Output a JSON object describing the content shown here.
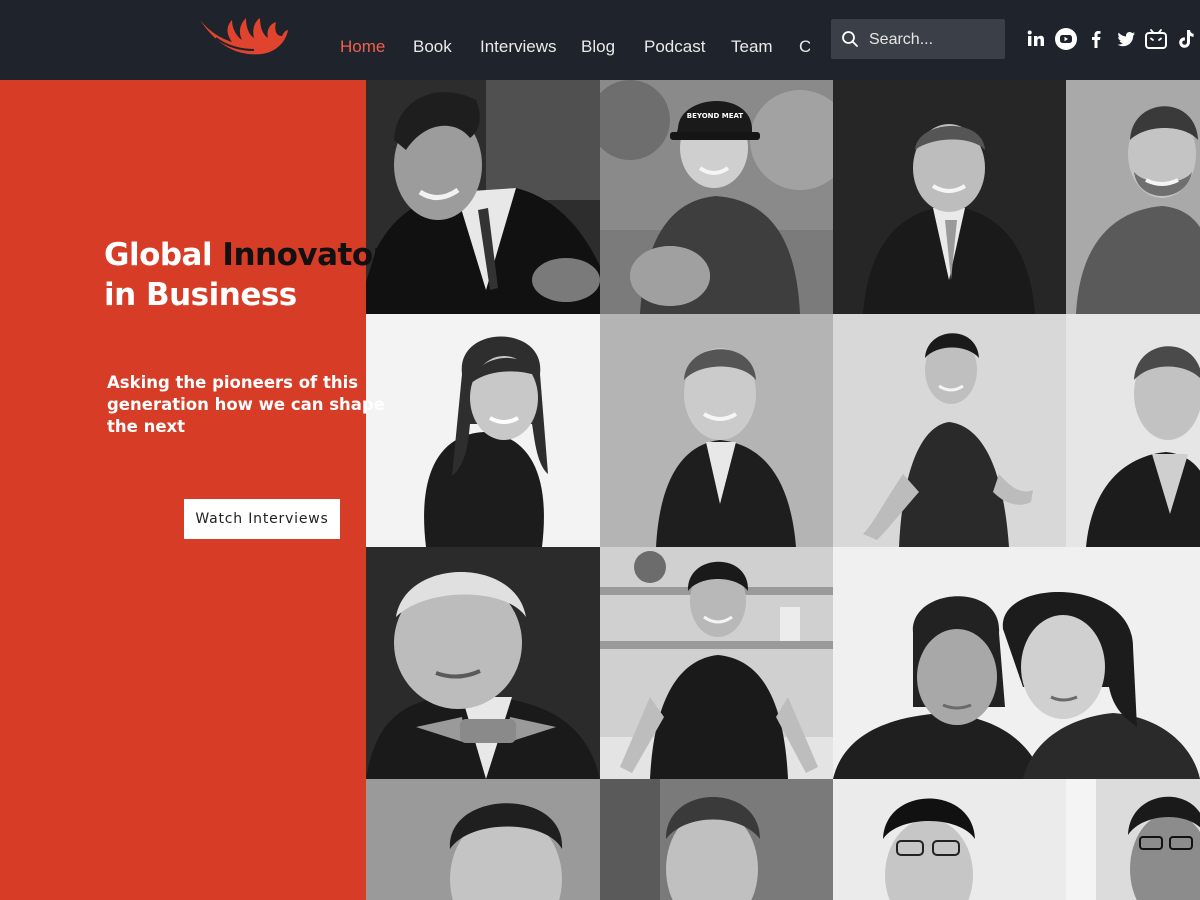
{
  "header": {
    "logo_icon": "flame-wing-logo",
    "nav": [
      {
        "label": "Home",
        "active": true
      },
      {
        "label": "Book"
      },
      {
        "label": "Interviews"
      },
      {
        "label": "Blog"
      },
      {
        "label": "Podcast"
      },
      {
        "label": "Team"
      },
      {
        "label": "C"
      }
    ],
    "search": {
      "placeholder": "Search..."
    },
    "social": [
      "linkedin-icon",
      "youtube-icon",
      "facebook-icon",
      "twitter-icon",
      "bilibili-icon",
      "tiktok-icon"
    ]
  },
  "hero": {
    "title_part1": "Global ",
    "title_part2": "Innovators",
    "title_line2": "in Business",
    "subtitle": "Asking the pioneers of this generation how we can shape the next",
    "cta_label": "Watch Interviews"
  },
  "photos": {
    "cap_text": "BEYOND MEAT"
  },
  "colors": {
    "header_bg": "#1f232b",
    "hero_bg": "#d63c26",
    "accent_nav": "#f0604f"
  }
}
